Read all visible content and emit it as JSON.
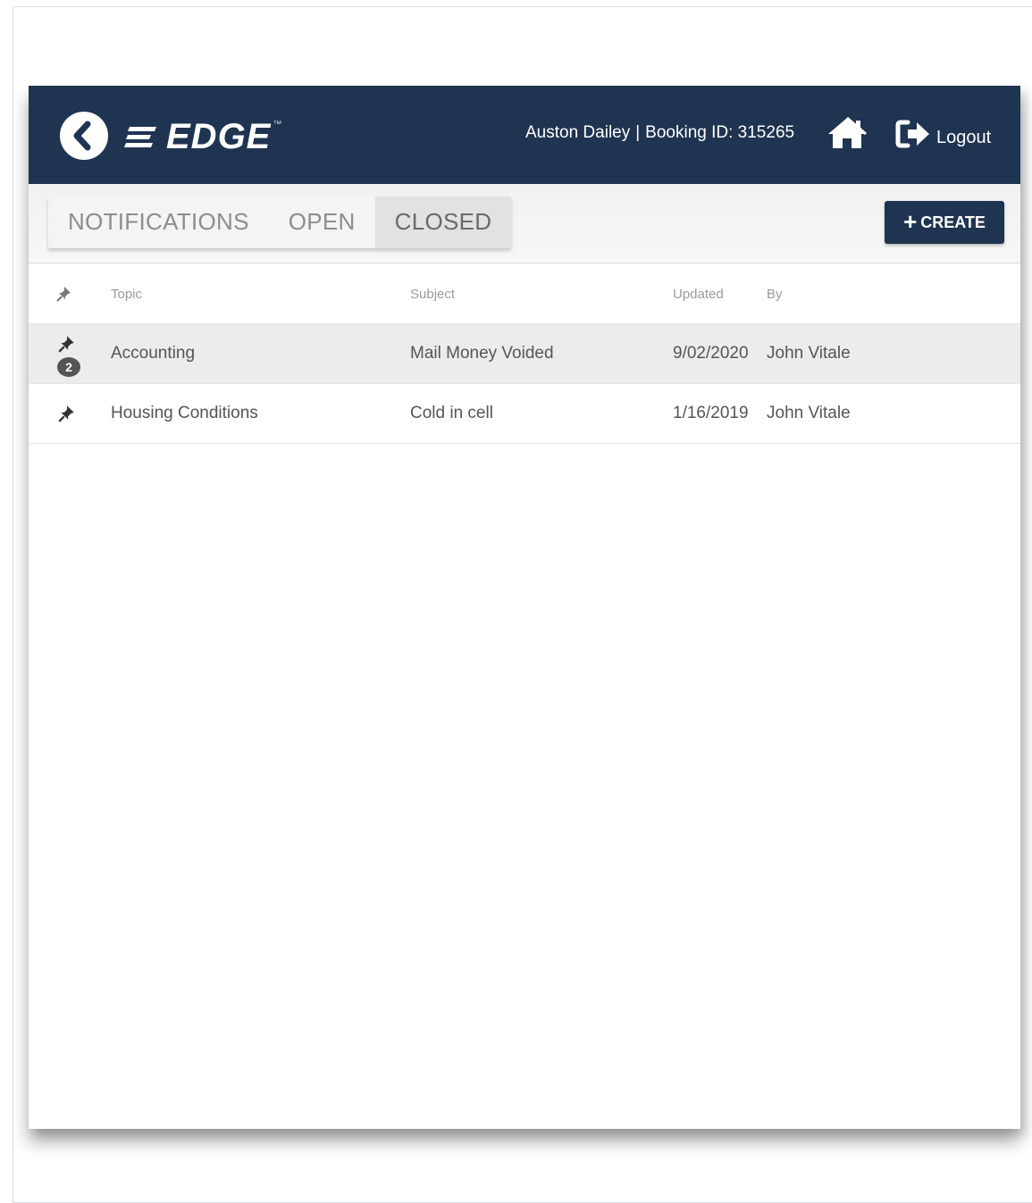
{
  "header": {
    "logo_text": "EDGE",
    "logo_tm": "™",
    "user_name": "Auston Dailey",
    "separator": "|",
    "booking_label": "Booking ID: 315265",
    "logout_label": "Logout",
    "brand_color": "#1f3450"
  },
  "icons": {
    "back": "chevron-left-circle-icon",
    "home": "home-icon",
    "logout": "sign-out-icon",
    "pin": "pin-icon"
  },
  "tabs": [
    {
      "label": "NOTIFICATIONS",
      "active": false
    },
    {
      "label": "OPEN",
      "active": false
    },
    {
      "label": "CLOSED",
      "active": true
    }
  ],
  "create_button": {
    "plus": "+",
    "label": "CREATE"
  },
  "table": {
    "columns": {
      "topic": "Topic",
      "subject": "Subject",
      "updated": "Updated",
      "by": "By"
    },
    "rows": [
      {
        "topic": "Accounting",
        "subject": "Mail Money Voided",
        "updated": "9/02/2020",
        "by": "John Vitale",
        "badge": "2",
        "highlighted": true
      },
      {
        "topic": "Housing Conditions",
        "subject": "Cold in cell",
        "updated": "1/16/2019",
        "by": "John Vitale",
        "badge": "",
        "highlighted": false
      }
    ]
  }
}
